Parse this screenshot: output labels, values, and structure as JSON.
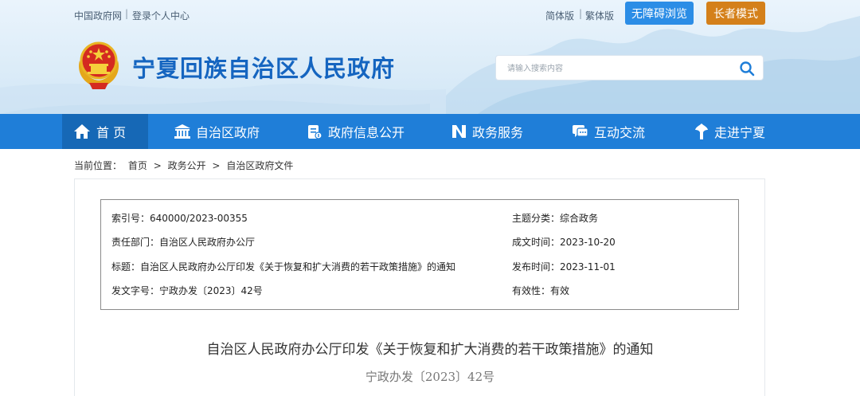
{
  "top_links": {
    "gov_portal": "中国政府网",
    "separator": "|",
    "login": "登录个人中心",
    "simplified": "简体版",
    "traditional": "繁体版"
  },
  "buttons": {
    "accessibility": "无障碍浏览",
    "elder_mode": "长者模式"
  },
  "site": {
    "title": "宁夏回族自治区人民政府"
  },
  "search": {
    "placeholder": "请输入搜索内容"
  },
  "nav": {
    "items": [
      {
        "label": "首 页",
        "icon": "home-icon"
      },
      {
        "label": "自治区政府",
        "icon": "government-building-icon"
      },
      {
        "label": "政府信息公开",
        "icon": "info-disclosure-icon"
      },
      {
        "label": "政务服务",
        "icon": "service-icon"
      },
      {
        "label": "互动交流",
        "icon": "chat-icon"
      },
      {
        "label": "走进宁夏",
        "icon": "explore-icon"
      }
    ],
    "active_color": "#1668b6",
    "bar_color": "#1f7ed8"
  },
  "breadcrumb": {
    "prefix": "当前位置：",
    "items": [
      "首页",
      "政务公开",
      "自治区政府文件"
    ],
    "separator": ">"
  },
  "info": {
    "index_no": "索引号：640000/2023-00355",
    "topic": "主题分类：综合政务",
    "department": "责任部门：自治区人民政府办公厅",
    "created": "成文时间：2023-10-20",
    "title": "标题：自治区人民政府办公厅印发《关于恢复和扩大消费的若干政策措施》的通知",
    "published": "发布时间：2023-11-01",
    "doc_no": "发文字号：宁政办发〔2023〕42号",
    "validity": "有效性：有效"
  },
  "document": {
    "title": "自治区人民政府办公厅印发《关于恢复和扩大消费的若干政策措施》的通知",
    "number": "宁政办发〔2023〕42号"
  },
  "colors": {
    "brand_blue": "#1565c0",
    "accessibility_button": "#2b8de6",
    "elder_button": "#d4801a"
  }
}
